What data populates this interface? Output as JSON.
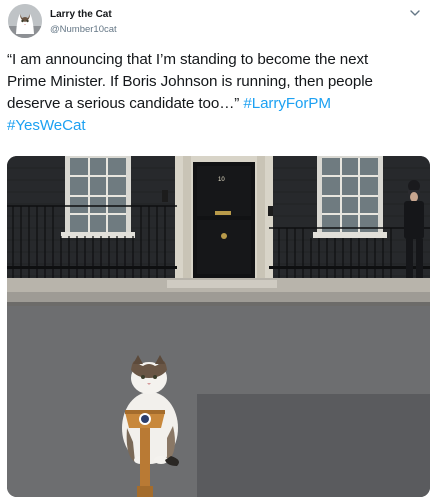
{
  "author": {
    "display_name": "Larry the Cat",
    "handle": "@Number10cat"
  },
  "tweet": {
    "text_line1": "“I am announcing that I’m standing to become the next",
    "text_line2": "Prime Minister. If Boris Johnson is running, then people",
    "text_line3_prefix": "deserve a serious candidate too…” ",
    "hashtags": [
      "#LarryForPM",
      "#YesWeCat"
    ]
  },
  "media": {
    "door_number": "10"
  },
  "icons": {
    "avatar": "cat-avatar-image",
    "menu": "chevron-down-icon"
  },
  "colors": {
    "link": "#1da1f2",
    "secondary_text": "#657786"
  }
}
